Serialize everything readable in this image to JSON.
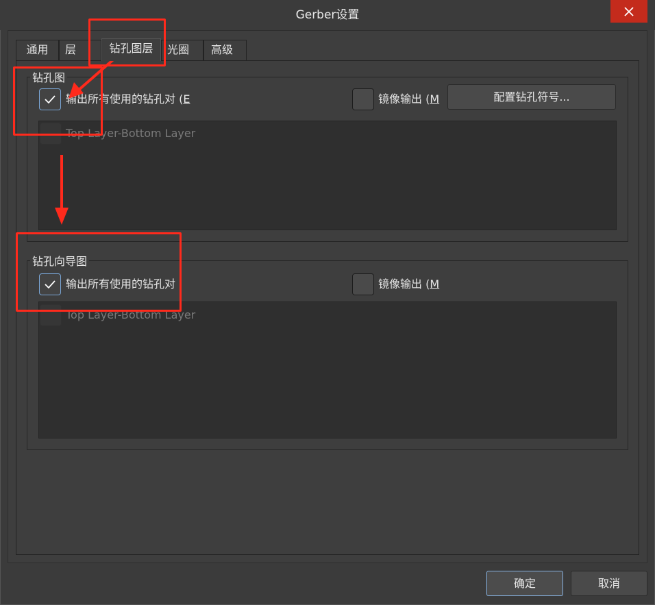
{
  "window": {
    "title": "Gerber设置"
  },
  "tabs": [
    {
      "label": "通用"
    },
    {
      "label": "层"
    },
    {
      "label": "钻孔图层"
    },
    {
      "label": "光圈"
    },
    {
      "label": "高级"
    }
  ],
  "drill_drawing": {
    "title": "钻孔图",
    "plot_all_label_main": "输出所有使用的钻孔对 (",
    "plot_all_label_mn": "E",
    "mirror_label_main": "镜像输出 (",
    "mirror_label_mn": "M",
    "configure_button": "配置钻孔符号...",
    "layer_pair": "Top Layer-Bottom Layer",
    "plot_all_checked": true,
    "mirror_checked": false
  },
  "drill_guide": {
    "title": "钻孔向导图",
    "plot_all_label_main": "输出所有使用的钻孔对",
    "mirror_label_main": "镜像输出 (",
    "mirror_label_mn": "M",
    "layer_pair": "Top Layer-Bottom Layer",
    "plot_all_checked": true,
    "mirror_checked": false
  },
  "footer": {
    "ok_label": "确定",
    "cancel_label": "取消"
  },
  "colors": {
    "annotation_red": "#ff2a1c",
    "focus_blue": "#88b4e4",
    "close_red": "#c42b1c"
  }
}
